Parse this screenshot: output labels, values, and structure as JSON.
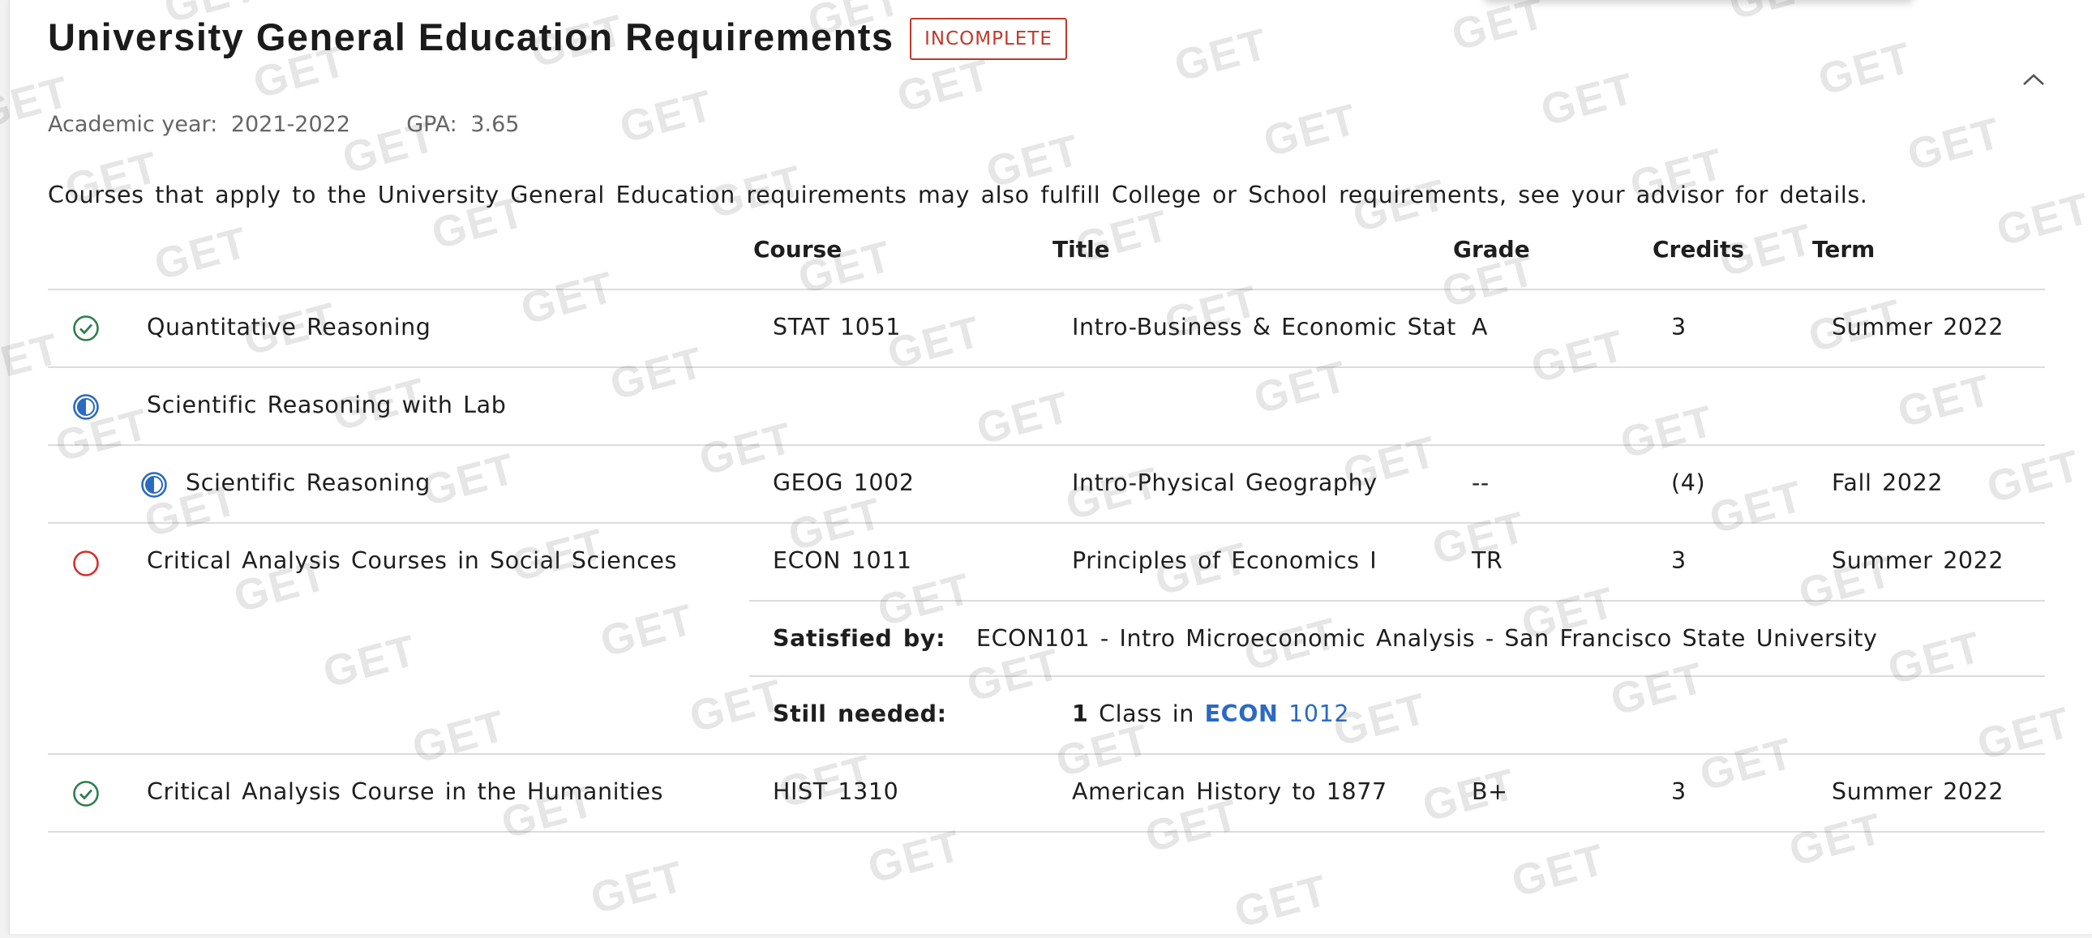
{
  "header": {
    "title": "University General Education Requirements",
    "status_badge": "INCOMPLETE"
  },
  "meta": {
    "academic_year_label": "Academic year:",
    "academic_year_value": "2021-2022",
    "gpa_label": "GPA:",
    "gpa_value": "3.65"
  },
  "description": "Courses that apply to the University General Education requirements may also fulfill College or School requirements, see your advisor for details.",
  "table": {
    "columns": {
      "course": "Course",
      "title": "Title",
      "grade": "Grade",
      "credits": "Credits",
      "term": "Term"
    },
    "rows": [
      {
        "status": "complete",
        "requirement": "Quantitative Reasoning",
        "course": "STAT 1051",
        "title": "Intro-Business & Economic Stat",
        "grade": "A",
        "credits": "3",
        "term": "Summer 2022"
      },
      {
        "status": "in-progress",
        "requirement": "Scientific Reasoning with Lab",
        "course": "",
        "title": "",
        "grade": "",
        "credits": "",
        "term": ""
      },
      {
        "status": "in-progress",
        "requirement": "Scientific Reasoning",
        "course": "GEOG 1002",
        "title": "Intro-Physical Geography",
        "grade": "--",
        "credits": "(4)",
        "term": "Fall 2022"
      },
      {
        "status": "not-started",
        "requirement": "Critical Analysis Courses in Social Sciences",
        "course": "ECON 1011",
        "title": "Principles of Economics I",
        "grade": "TR",
        "credits": "3",
        "term": "Summer 2022",
        "satisfied_by_label": "Satisfied by:",
        "satisfied_by_value": "ECON101 - Intro Microeconomic Analysis - San Francisco State University",
        "still_needed_label": "Still needed:",
        "still_needed_count": "1",
        "still_needed_text": "Class in",
        "still_needed_subject": "ECON",
        "still_needed_number": "1012"
      },
      {
        "status": "complete",
        "requirement": "Critical Analysis Course in the Humanities",
        "course": "HIST 1310",
        "title": "American History to 1877",
        "grade": "B+",
        "credits": "3",
        "term": "Summer 2022"
      }
    ]
  },
  "watermark_text": "GET",
  "colors": {
    "complete": "#2e7d4f",
    "in_progress": "#2a6ac3",
    "not_started": "#d32f2f",
    "badge": "#c0392b",
    "link": "#2a6ac3"
  },
  "icons": {
    "complete": "check-circle-icon",
    "in_progress": "half-circle-icon",
    "not_started": "empty-circle-icon",
    "collapse": "chevron-up-icon"
  }
}
